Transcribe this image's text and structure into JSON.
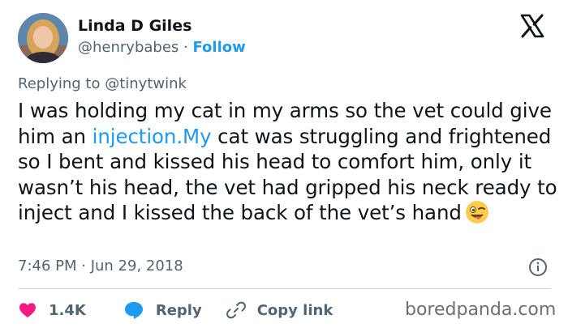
{
  "author": {
    "name": "Linda D Giles",
    "handle": "@henrybabes",
    "separator": "·",
    "follow_label": "Follow"
  },
  "reply_context": {
    "prefix": "Replying to",
    "mention": "@tinytwink"
  },
  "tweet": {
    "text_part1": "I was holding my cat in my arms so the vet could give him an ",
    "link_text": "injection.My",
    "text_part2": " cat was struggling and frightened so I bent and kissed his head to comfort him, only it wasn’t his head, the vet had gripped his neck ready to inject and I kissed the back of the vet’s hand",
    "emoji": "winking-face-with-tongue"
  },
  "timestamp": "7:46 PM · Jun 29, 2018",
  "actions": {
    "like_count": "1.4K",
    "reply_label": "Reply",
    "copy_label": "Copy link"
  },
  "watermark": "boredpanda.com",
  "colors": {
    "accent": "#1d9bf0",
    "like": "#f91880",
    "text": "#0f1419",
    "muted": "#536471"
  },
  "icons": [
    "x-logo-icon",
    "info-icon",
    "heart-icon",
    "reply-bubble-icon",
    "link-icon"
  ]
}
